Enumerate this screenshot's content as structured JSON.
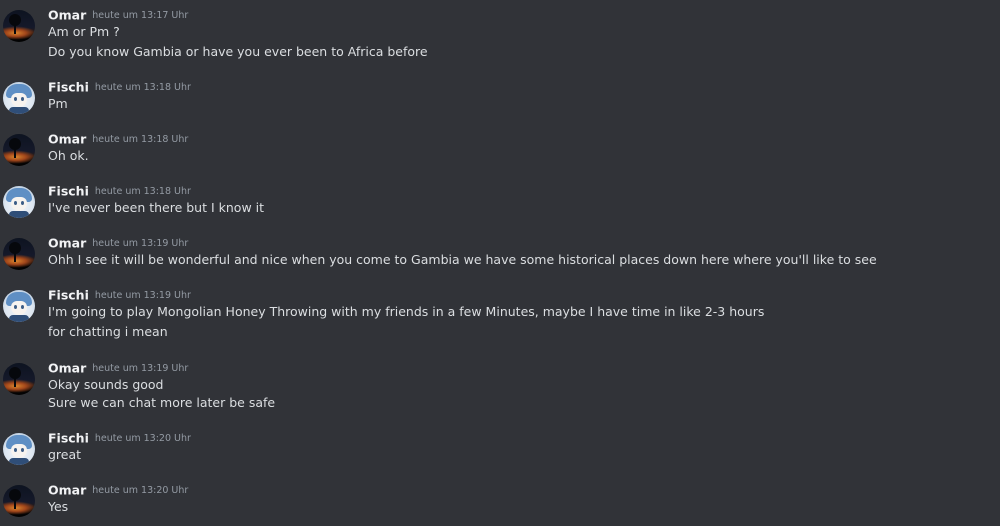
{
  "messages": [
    {
      "author": "Omar",
      "time": "heute um 13:17 Uhr",
      "lines": [
        "Am or Pm ?",
        "Do you know Gambia or have you ever been to Africa before"
      ]
    },
    {
      "author": "Fischi",
      "time": "heute um 13:18 Uhr",
      "lines": [
        "Pm"
      ]
    },
    {
      "author": "Omar",
      "time": "heute um 13:18 Uhr",
      "lines": [
        "Oh ok."
      ]
    },
    {
      "author": "Fischi",
      "time": "heute um 13:18 Uhr",
      "lines": [
        "I've never been there but I know it"
      ]
    },
    {
      "author": "Omar",
      "time": "heute um 13:19 Uhr",
      "lines": [
        "Ohh I see it will be wonderful  and nice when you come to Gambia we have some historical places down here where you'll like to see"
      ]
    },
    {
      "author": "Fischi",
      "time": "heute um 13:19 Uhr",
      "lines": [
        "I'm going to play Mongolian Honey Throwing with my friends in a few Minutes, maybe I have time in like 2-3 hours",
        "for chatting i mean"
      ]
    },
    {
      "author": "Omar",
      "time": "heute um 13:19 Uhr",
      "lines": [
        "Okay sounds good",
        "Sure we can chat more later be safe"
      ]
    },
    {
      "author": "Fischi",
      "time": "heute um 13:20 Uhr",
      "lines": [
        "great"
      ]
    },
    {
      "author": "Omar",
      "time": "heute um 13:20 Uhr",
      "lines": [
        "Yes"
      ]
    }
  ]
}
